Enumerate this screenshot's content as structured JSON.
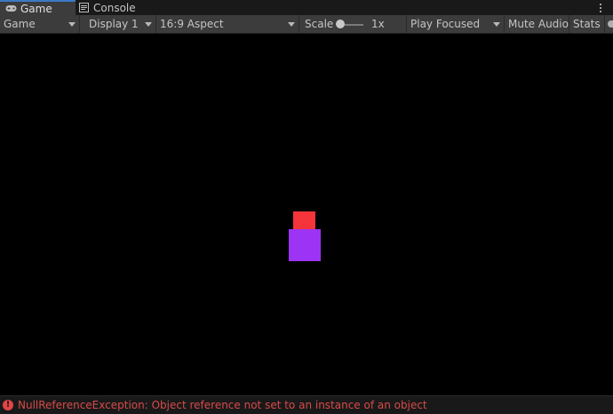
{
  "tabs": [
    {
      "label": "Game",
      "icon": "gamepad-icon",
      "active": true
    },
    {
      "label": "Console",
      "icon": "console-icon",
      "active": false
    }
  ],
  "toolbar": {
    "view_mode": "Game",
    "display": "Display 1",
    "aspect": "16:9 Aspect",
    "scale_label": "Scale",
    "scale_value": "1x",
    "play_mode": "Play Focused",
    "mute_audio": "Mute Audio",
    "stats": "Stats"
  },
  "scene": {
    "objects": [
      {
        "name": "red-block",
        "color": "#f5353a"
      },
      {
        "name": "purple-block",
        "color": "#9d33f5"
      }
    ]
  },
  "status": {
    "icon": "error-icon",
    "message": "NullReferenceException: Object reference not set to an instance of an object"
  },
  "colors": {
    "accent": "#3c78c8",
    "error": "#d84a4a",
    "toolbar_bg": "#3c3c3c",
    "viewport_bg": "#000000"
  }
}
